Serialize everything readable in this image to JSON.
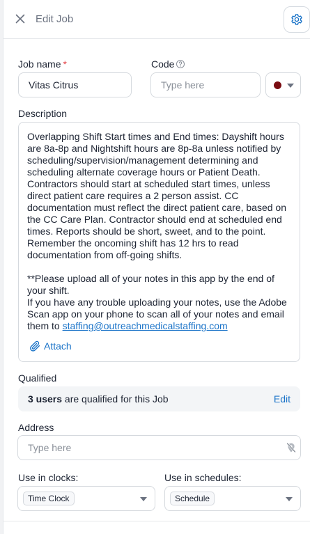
{
  "header": {
    "title": "Edit Job",
    "close_icon": "close-icon",
    "settings_icon": "gear-icon"
  },
  "job_name": {
    "label": "Job name",
    "required_mark": "*",
    "value": "Vitas Citrus"
  },
  "code": {
    "label": "Code",
    "placeholder": "Type here",
    "help_icon": "question-circle-icon"
  },
  "color_picker": {
    "selected_color": "#7a0c12"
  },
  "description": {
    "label": "Description",
    "paragraph_1": "Overlapping Shift Start times and End times:  Dayshift hours are 8a-8p and Nightshift hours are 8p-8a unless notified by scheduling/supervision/management determining and scheduling alternate coverage hours or Patient Death. Contractors should start at scheduled start times, unless direct patient care requires a 2 person assist. CC documentation must reflect the direct patient care, based on the CC Care Plan. Contractor should end at scheduled end times. Reports should be short, sweet, and to the point. Remember the oncoming shift has 12 hrs to read documentation from off-going shifts.",
    "paragraph_2": "**Please upload all of your notes in this app by the end of your shift.",
    "paragraph_3_prefix": "If you have any trouble uploading your notes, use the Adobe Scan app on your phone to scan all of your notes and email them to ",
    "email_link": "staffing@outreachmedicalstaffing.com",
    "attach_label": "Attach",
    "attach_icon": "paperclip-icon"
  },
  "qualified": {
    "label": "Qualified",
    "count_text": "3 users",
    "rest_text": " are qualified for this Job",
    "edit_label": "Edit"
  },
  "address": {
    "label": "Address",
    "placeholder": "Type here",
    "location_icon": "location-off-icon"
  },
  "clocks": {
    "label": "Use in clocks:",
    "selected": "Time Clock"
  },
  "schedules": {
    "label": "Use in schedules:",
    "selected": "Schedule"
  },
  "colors": {
    "accent": "#1a73c8",
    "required": "#e5484d"
  }
}
